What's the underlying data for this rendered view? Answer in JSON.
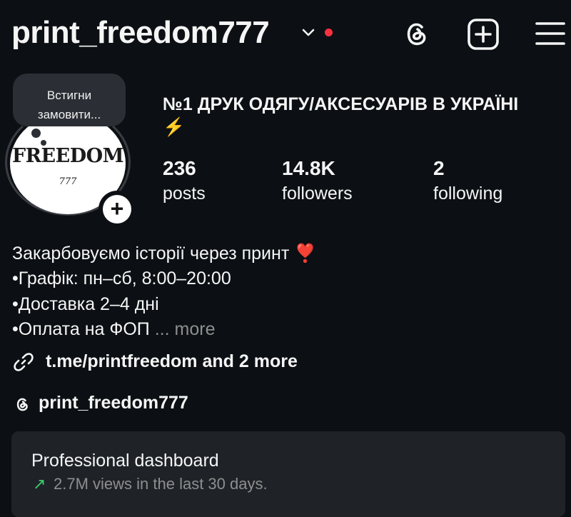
{
  "header": {
    "username": "print_freedom777",
    "icons": [
      "chevron-down-icon",
      "notification-dot",
      "threads-icon",
      "add-post-icon",
      "menu-icon"
    ],
    "accent_dot_color": "#ff3040"
  },
  "avatar": {
    "logo_text": "FREEDOM",
    "logo_sub": "777",
    "note": "Встигни замовити..."
  },
  "profile": {
    "display_name": "№1 ДРУК ОДЯГУ/АКСЕСУАРІВ В УКРАЇНІ ⚡",
    "stats": {
      "posts_count": "236",
      "posts_label": "posts",
      "followers_count": "14.8K",
      "followers_label": "followers",
      "following_count": "2",
      "following_label": "following"
    }
  },
  "bio": {
    "line1": "Закарбовуємо історії через принт ❣️",
    "line2": "•Графік: пн–сб, 8:00–20:00",
    "line3": "•Доставка 2–4 дні",
    "line4": "•Оплата на ФОП",
    "ellipsis": "...",
    "more": "more"
  },
  "links": {
    "text": "t.me/printfreedom and 2 more",
    "threads_handle": "print_freedom777"
  },
  "dashboard": {
    "title": "Professional dashboard",
    "arrow": "↗",
    "subtitle": "2.7M views in the last 30 days.",
    "trend_color": "#3acf6b"
  }
}
